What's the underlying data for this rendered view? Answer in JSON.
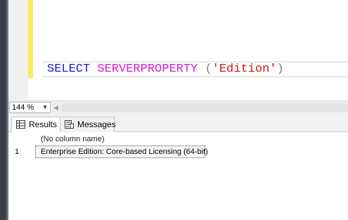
{
  "editor": {
    "code_tokens": {
      "keyword": "SELECT",
      "function": "SERVERPROPERTY",
      "open_paren": "(",
      "string": "'Edition'",
      "close_paren": ")"
    }
  },
  "zoom": {
    "value": "144 %"
  },
  "results": {
    "tabs": [
      {
        "label": "Results",
        "icon": "grid-icon",
        "active": true
      },
      {
        "label": "Messages",
        "icon": "messages-icon",
        "active": false
      }
    ],
    "column_header": "(No column name)",
    "rows": [
      {
        "num": "1",
        "value": "Enterprise Edition: Core-based Licensing (64-bit)"
      }
    ]
  },
  "colors": {
    "keyword": "#1a1ad6",
    "function": "#d31bd3",
    "string": "#d01818",
    "operator": "#808080",
    "change_bar": "#f6eb58"
  }
}
